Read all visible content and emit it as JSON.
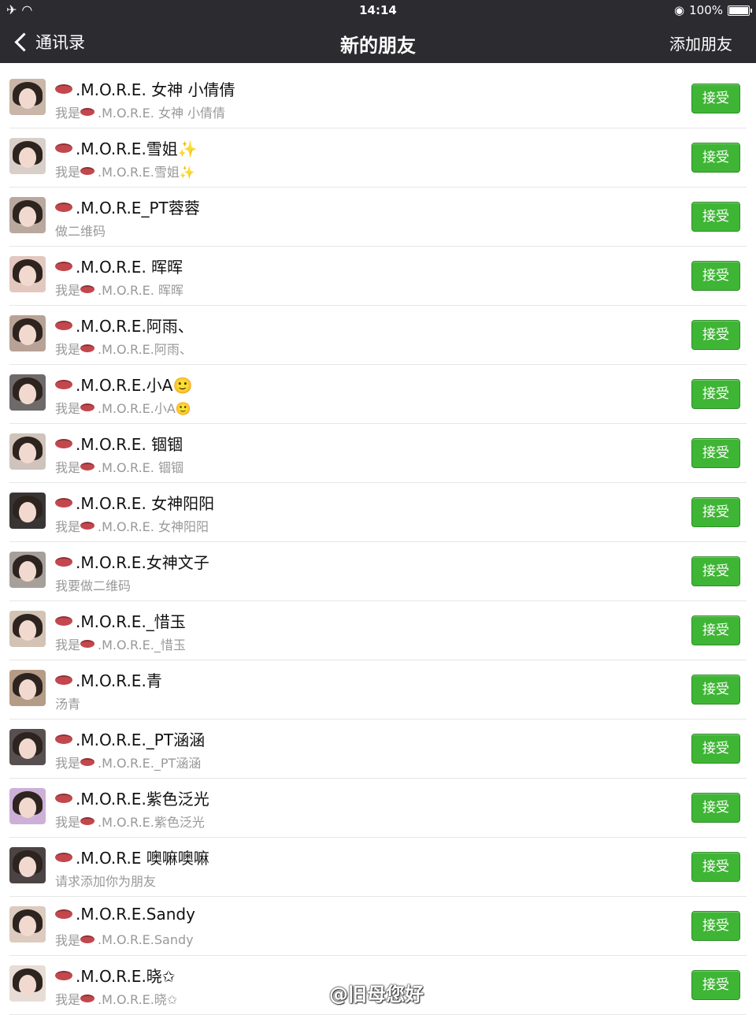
{
  "status_bar": {
    "airplane": "✈",
    "wifi": "◠",
    "time": "14:14",
    "battery": "100%"
  },
  "nav": {
    "back_label": "通讯录",
    "title": "新的朋友",
    "add_friend": "添加朋友"
  },
  "accept_label": "接受",
  "rows": [
    {
      "name": ".M.O.R.E. 女神 小倩倩",
      "msg_prefix": "我是",
      "msg_lip": true,
      "msg": ".M.O.R.E. 女神 小倩倩"
    },
    {
      "name": ".M.O.R.E.雪姐✨",
      "msg_prefix": "我是",
      "msg_lip": true,
      "msg": ".M.O.R.E.雪姐✨"
    },
    {
      "name": ".M.O.R.E_PT蓉蓉",
      "msg_prefix": "",
      "msg_lip": false,
      "msg": "做二维码"
    },
    {
      "name": ".M.O.R.E. 晖晖",
      "msg_prefix": "我是",
      "msg_lip": true,
      "msg": ".M.O.R.E. 晖晖"
    },
    {
      "name": ".M.O.R.E.阿雨、",
      "msg_prefix": "我是",
      "msg_lip": true,
      "msg": ".M.O.R.E.阿雨、"
    },
    {
      "name": ".M.O.R.E.小A🙂",
      "msg_prefix": "我是",
      "msg_lip": true,
      "msg": ".M.O.R.E.小A🙂"
    },
    {
      "name": " .M.O.R.E. 锢锢",
      "msg_prefix": "我是",
      "msg_lip": true,
      "msg": " .M.O.R.E. 锢锢"
    },
    {
      "name": ".M.O.R.E. 女神阳阳",
      "msg_prefix": "我是",
      "msg_lip": true,
      "msg": ".M.O.R.E. 女神阳阳"
    },
    {
      "name": ".M.O.R.E.女神文子",
      "msg_prefix": "",
      "msg_lip": false,
      "msg": "我要做二维码"
    },
    {
      "name": " .M.O.R.E._惜玉",
      "msg_prefix": "我是",
      "msg_lip": true,
      "msg": " .M.O.R.E._惜玉"
    },
    {
      "name": " .M.O.R.E.青",
      "msg_prefix": "",
      "msg_lip": false,
      "msg": "汤青"
    },
    {
      "name": ".M.O.R.E._PT涵涵",
      "msg_prefix": "我是",
      "msg_lip": true,
      "msg": ".M.O.R.E._PT涵涵"
    },
    {
      "name": ".M.O.R.E.紫色泛光",
      "msg_prefix": "我是",
      "msg_lip": true,
      "msg": ".M.O.R.E.紫色泛光"
    },
    {
      "name": ".M.O.R.E 噢嘛噢嘛",
      "msg_prefix": "",
      "msg_lip": false,
      "msg": "请求添加你为朋友"
    },
    {
      "name": ".M.O.R.E.Sandy",
      "msg_prefix": "我是",
      "msg_lip": true,
      "msg": ".M.O.R.E.Sandy"
    },
    {
      "name": ".M.O.R.E.晓✩",
      "msg_prefix": "我是",
      "msg_lip": true,
      "msg": ".M.O.R.E.晓✩"
    }
  ],
  "watermark": "@旧母您好"
}
